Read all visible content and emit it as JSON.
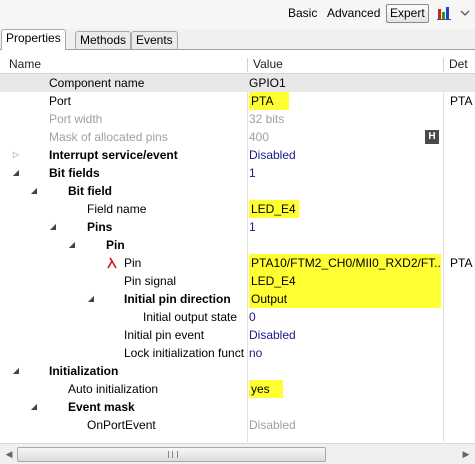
{
  "toolbar": {
    "basic": "Basic",
    "advanced": "Advanced",
    "expert": "Expert",
    "chart_icon": "bar-chart-icon",
    "menu_icon": "chevron-down-icon"
  },
  "tabs": [
    "Properties",
    "Methods",
    "Events"
  ],
  "columns": {
    "name": "Name",
    "value": "Value",
    "details": "Det"
  },
  "rows": [
    {
      "name": "Component name",
      "value": "GPIO1",
      "details": ""
    },
    {
      "name": "Port",
      "value": "PTA",
      "details": "PTA"
    },
    {
      "name": "Port width",
      "value": "32 bits",
      "details": ""
    },
    {
      "name": "Mask of allocated pins",
      "value": "400",
      "details": "",
      "button": "H"
    },
    {
      "name": "Interrupt service/event",
      "value": "Disabled",
      "details": ""
    },
    {
      "name": "Bit fields",
      "value": "1",
      "details": ""
    },
    {
      "name": "Bit field",
      "value": "",
      "details": ""
    },
    {
      "name": "Field name",
      "value": "LED_E4",
      "details": ""
    },
    {
      "name": "Pins",
      "value": "1",
      "details": ""
    },
    {
      "name": "Pin",
      "value": "",
      "details": ""
    },
    {
      "name": "Pin",
      "value": "PTA10/FTM2_CH0/MII0_RXD2/FT...",
      "details": "PTA"
    },
    {
      "name": "Pin signal",
      "value": "LED_E4",
      "details": ""
    },
    {
      "name": "Initial pin direction",
      "value": "Output",
      "details": ""
    },
    {
      "name": "Initial output state",
      "value": "0",
      "details": ""
    },
    {
      "name": "Initial pin event",
      "value": "Disabled",
      "details": ""
    },
    {
      "name": "Lock initialization funct",
      "value": "no",
      "details": ""
    },
    {
      "name": "Initialization",
      "value": "",
      "details": ""
    },
    {
      "name": "Auto initialization",
      "value": "yes",
      "details": ""
    },
    {
      "name": "Event mask",
      "value": "",
      "details": ""
    },
    {
      "name": "OnPortEvent",
      "value": "Disabled",
      "details": ""
    }
  ],
  "colors": {
    "highlight": "#ffff33",
    "value_text": "#1a1a8c",
    "disabled_text": "#a0a0a0"
  }
}
